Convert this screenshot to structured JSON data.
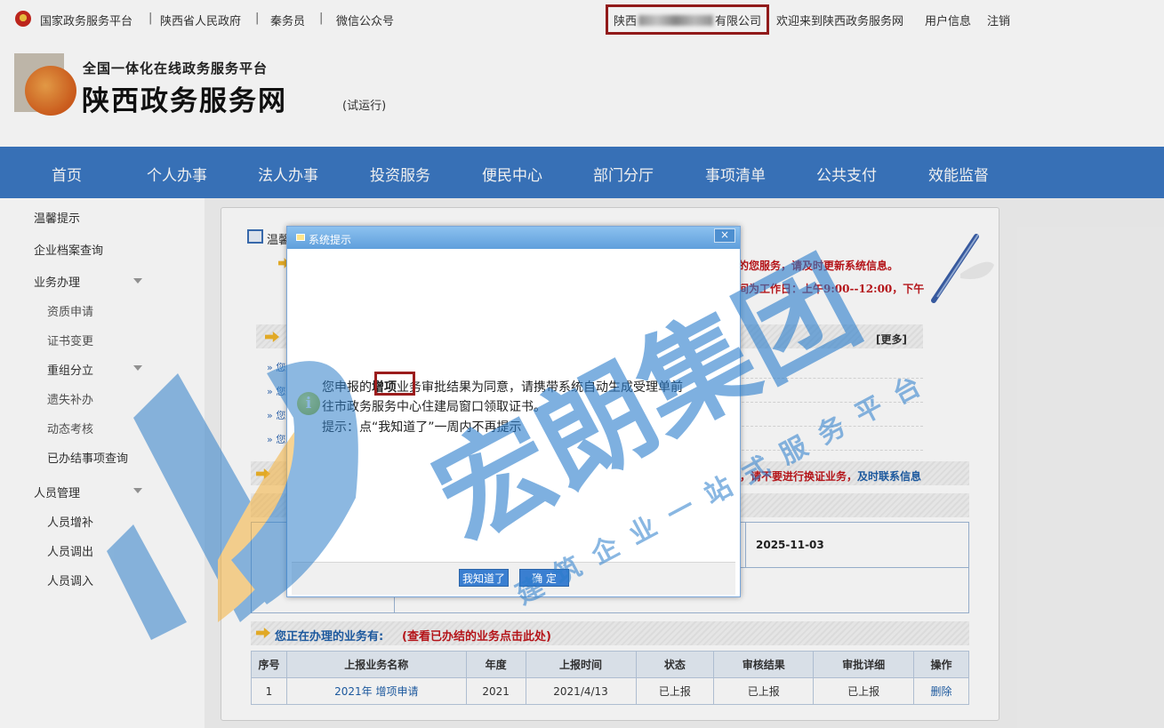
{
  "topbar": {
    "links": [
      "国家政务服务平台",
      "陕西省人民政府",
      "秦务员",
      "微信公众号"
    ],
    "company_prefix": "陕西",
    "company_suffix": "有限公司",
    "welcome": "欢迎来到陕西政务服务网",
    "user_info": "用户信息",
    "logout": "注销"
  },
  "header": {
    "platform": "全国一体化在线政务服务平台",
    "site_name": "陕西政务服务网",
    "trial": "(试运行)"
  },
  "nav": [
    "首页",
    "个人办事",
    "法人办事",
    "投资服务",
    "便民中心",
    "部门分厅",
    "事项清单",
    "公共支付",
    "效能监督"
  ],
  "sidebar": {
    "items": [
      "温馨提示",
      "企业档案查询",
      "业务办理"
    ],
    "business_subs": [
      "资质申请",
      "证书变更",
      "重组分立",
      "遗失补办",
      "动态考核",
      "已办结事项查询"
    ],
    "people": "人员管理",
    "people_subs": [
      "人员增补",
      "人员调出",
      "人员调入"
    ]
  },
  "notice": {
    "title": "温馨",
    "line1": "的您服务，请及时更新系统信息。",
    "line2": "间为工作日：上午9:00--12:00，下午",
    "more": "[更多]",
    "list_prefix": "您"
  },
  "errors_notice": {
    "text": "误，请不要进行换证业务，",
    "link": "及时联系信息"
  },
  "info": {
    "date_label": ":",
    "date": "2025-11-03"
  },
  "doing": {
    "title": "您正在办理的业务有:",
    "link": "(查看已办结的业务点击此处)",
    "headers": [
      "序号",
      "上报业务名称",
      "年度",
      "上报时间",
      "状态",
      "审核结果",
      "审批详细",
      "操作"
    ],
    "rows": [
      [
        "1",
        "2021年 增项申请",
        "2021",
        "2021/4/13",
        "已上报",
        "已上报",
        "已上报",
        "删除"
      ]
    ]
  },
  "dialog": {
    "title": "系统提示",
    "close": "×",
    "msg_line1_a": "您申报的",
    "msg_highlight": "增项",
    "msg_line1_b": "业务审批结果为同意，请携带系统自动生成受理单前",
    "msg_line2": "往市政务服务中心住建局窗口领取证书。",
    "msg_line3": "提示：点“我知道了”一周内不再提示",
    "btn_know": "我知道了",
    "btn_ok": "确 定"
  },
  "watermark": {
    "big": "宏朗集团",
    "small": "建筑企业一站式服务平台"
  },
  "colors": {
    "nav_blue": "#3b78c2",
    "highlight_border": "#9b1c1c",
    "notice_red": "#c0161b",
    "link_blue": "#1f5fa8"
  }
}
